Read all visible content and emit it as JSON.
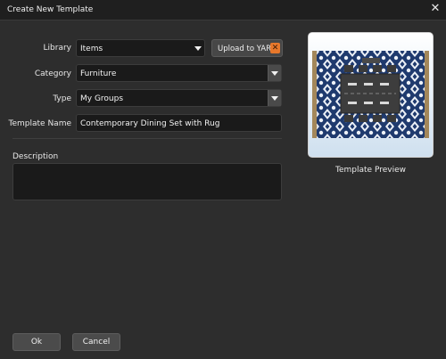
{
  "window": {
    "title": "Create New Template",
    "close_icon": "close-icon"
  },
  "form": {
    "library": {
      "label": "Library",
      "value": "Items"
    },
    "upload_button": {
      "label": "Upload to YARD",
      "accent_color": "#e8782b"
    },
    "category": {
      "label": "Category",
      "value": "Furniture"
    },
    "type": {
      "label": "Type",
      "value": "My Groups"
    },
    "template_name": {
      "label": "Template Name",
      "value": "Contemporary Dining Set with Rug"
    },
    "description": {
      "label": "Description",
      "value": ""
    }
  },
  "preview": {
    "caption": "Template Preview"
  },
  "buttons": {
    "ok": "Ok",
    "cancel": "Cancel"
  }
}
